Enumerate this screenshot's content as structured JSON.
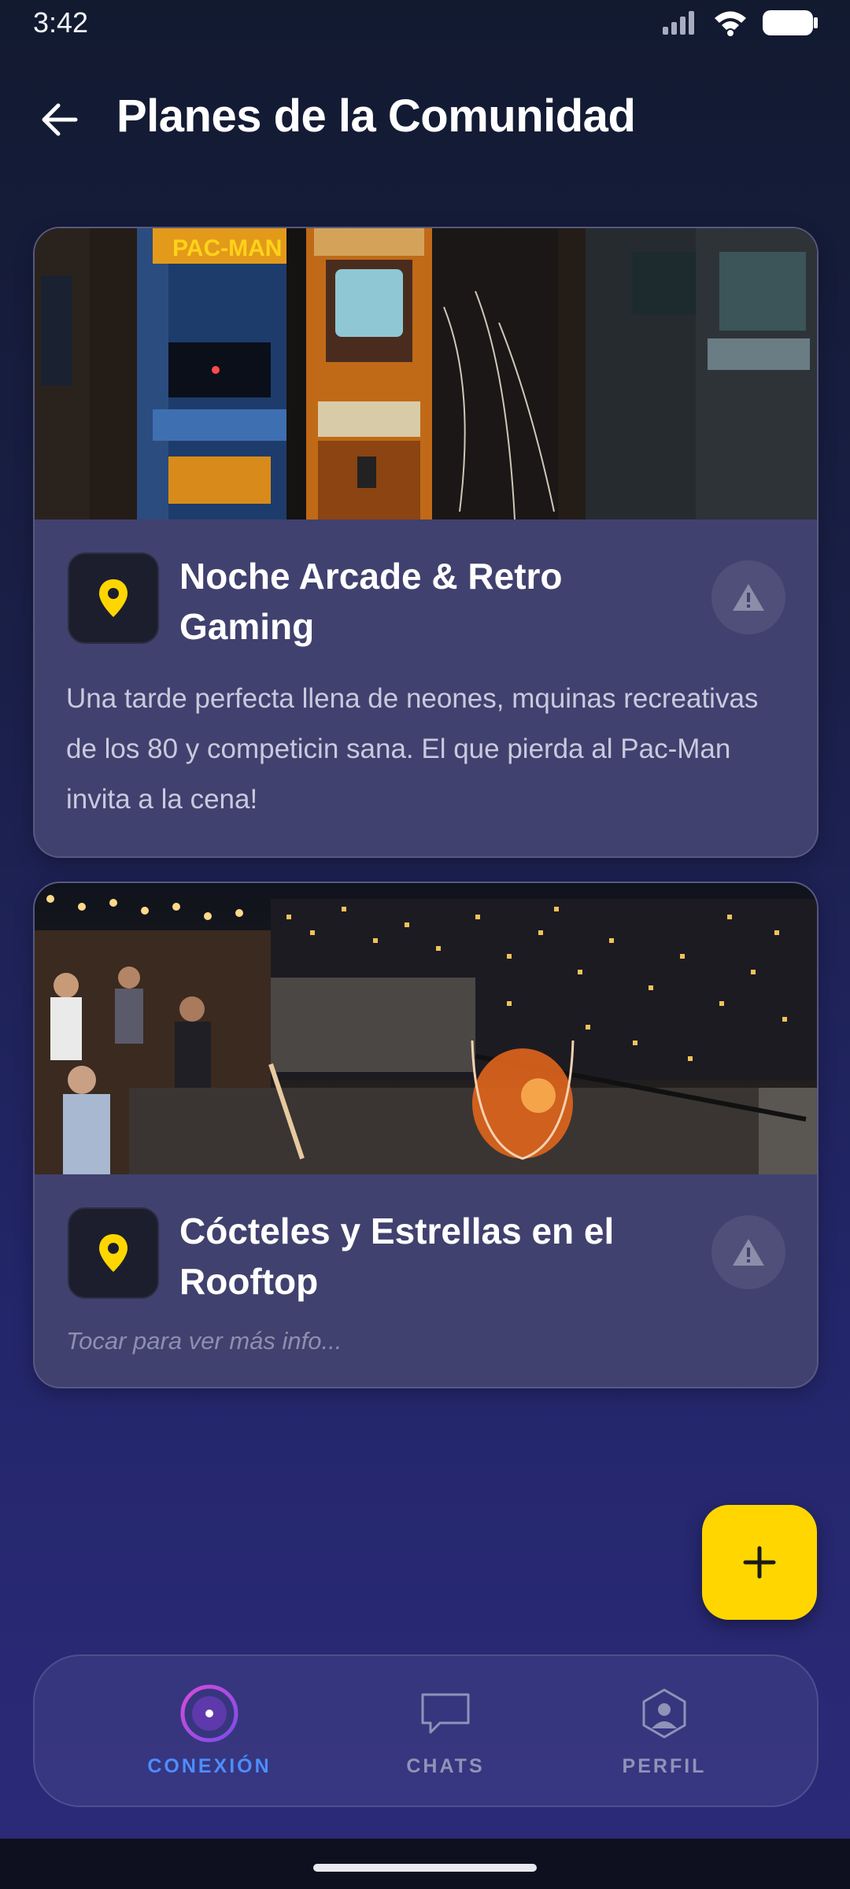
{
  "status_bar": {
    "time": "3:42"
  },
  "header": {
    "title": "Planes de la Comunidad"
  },
  "plans": [
    {
      "title": "Noche Arcade & Retro Gaming",
      "description": "Una tarde perfecta llena de neones, mquinas recreativas de los 80 y competicin sana. El que pierda al Pac-Man invita a la cena!",
      "image_alt": "arcade-machines-photo",
      "icons": {
        "location": "location-pin-icon",
        "report": "warning-icon"
      }
    },
    {
      "title": "Cócteles y Estrellas en el Rooftop",
      "hint": "Tocar para ver más info...",
      "image_alt": "rooftop-bar-cocktail-photo",
      "icons": {
        "location": "location-pin-icon",
        "report": "warning-icon"
      }
    }
  ],
  "fab": {
    "icon": "plus-icon"
  },
  "bottom_nav": {
    "items": [
      {
        "label": "CONEXIÓN",
        "icon": "connection-target-icon",
        "active": true
      },
      {
        "label": "CHATS",
        "icon": "chat-bubble-icon",
        "active": false
      },
      {
        "label": "PERFIL",
        "icon": "profile-hexagon-icon",
        "active": false
      }
    ]
  },
  "colors": {
    "accent_yellow": "#ffd600",
    "nav_active": "#4d8dff",
    "nav_inactive": "#8f93b8",
    "card_bg": "#41416f"
  }
}
